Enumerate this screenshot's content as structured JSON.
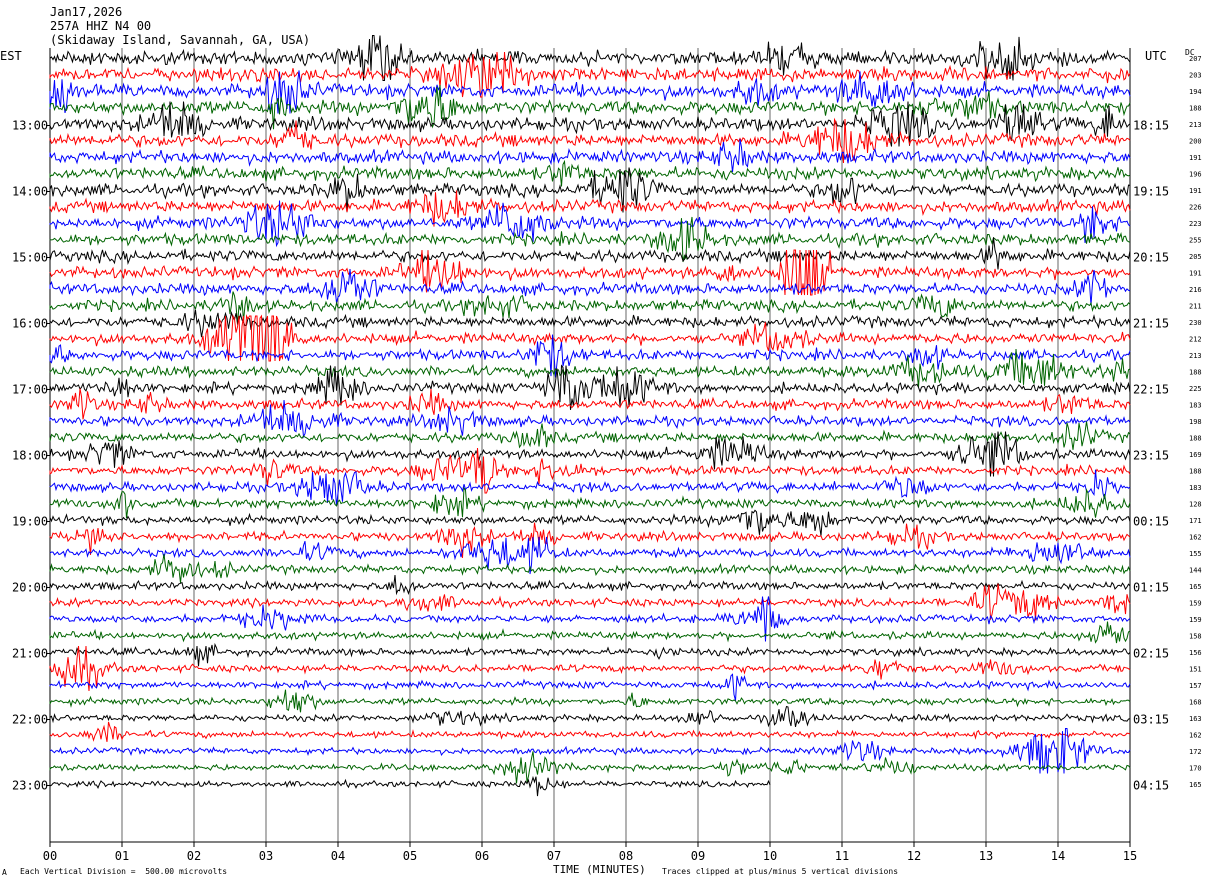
{
  "header": {
    "date": "Jan17,2026",
    "station": "257A HHZ N4 00",
    "location": "(Skidaway Island, Savannah, GA, USA)"
  },
  "left_label": "EST",
  "right_label": "UTC",
  "dc_label": "DC",
  "footer": {
    "xlabel": "TIME (MINUTES)",
    "scale_note": "Each Vertical Division =  500.00 microvolts",
    "clip_note": "Traces clipped at plus/minus 5 vertical divisions",
    "corner_mark": "A"
  },
  "chart_data": {
    "type": "line",
    "title": "",
    "xlabel": "TIME (MINUTES)",
    "xlim": [
      0,
      15
    ],
    "x_ticks": [
      "00",
      "01",
      "02",
      "03",
      "04",
      "05",
      "06",
      "07",
      "08",
      "09",
      "10",
      "11",
      "12",
      "13",
      "14",
      "15"
    ],
    "left_hour_labels": [
      "13:00",
      "14:00",
      "15:00",
      "16:00",
      "17:00",
      "18:00",
      "19:00",
      "20:00",
      "21:00",
      "22:00",
      "23:00"
    ],
    "right_hour_labels": [
      "18:15",
      "19:15",
      "20:15",
      "21:15",
      "22:15",
      "23:15",
      "00:15",
      "01:15",
      "02:15",
      "03:15",
      "04:15"
    ],
    "trace_colors": [
      "#000000",
      "#ff0000",
      "#0000ff",
      "#006400"
    ],
    "dc_values": [
      "207",
      "203",
      "194",
      "188",
      "213",
      "200",
      "191",
      "196",
      "191",
      "226",
      "223",
      "255",
      "205",
      "191",
      "216",
      "211",
      "230",
      "212",
      "213",
      "188",
      "225",
      "183",
      "198",
      "188",
      "169",
      "188",
      "183",
      "128",
      "171",
      "162",
      "155",
      "144",
      "165",
      "159",
      "159",
      "158",
      "156",
      "151",
      "157",
      "168",
      "163",
      "162",
      "172",
      "170",
      "165"
    ],
    "last_trace_end_minute": 10.0
  }
}
